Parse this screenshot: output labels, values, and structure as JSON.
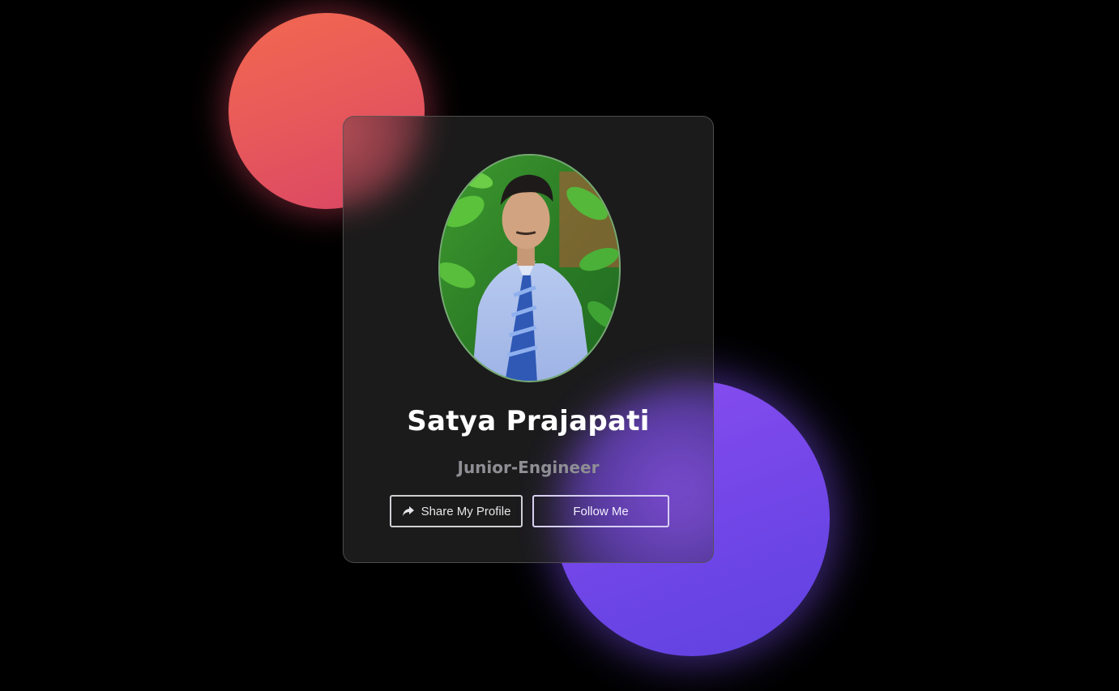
{
  "profile": {
    "name": "Satya Prajapati",
    "role": "Junior-Engineer",
    "avatar_alt": "Profile photo"
  },
  "actions": {
    "share_label": "Share My Profile",
    "follow_label": "Follow Me",
    "share_icon": "share-icon"
  },
  "colors": {
    "background": "#000000",
    "blob_coral": "#e85a5a",
    "blob_violet": "#7346e8",
    "card": "#1e1e1e",
    "name_text": "#ffffff",
    "role_text": "#8e8e94"
  }
}
